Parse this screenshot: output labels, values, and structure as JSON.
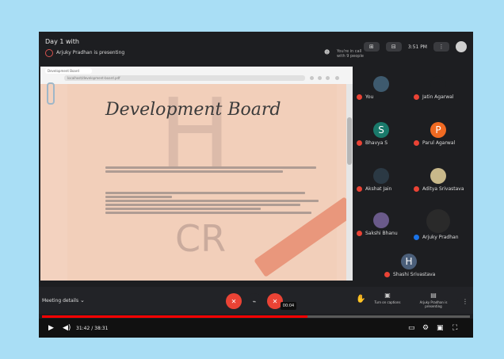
{
  "meeting": {
    "title": "Day 1 with",
    "presenting": "Arjuky Pradhan is presenting"
  },
  "topbar": {
    "hand_text": "You're in call with 9 people",
    "time": "3:51 PM"
  },
  "browser": {
    "tab": "Development Board",
    "address": "localhost/development-board.pdf"
  },
  "slide": {
    "title": "Development Board",
    "logo": "CR"
  },
  "participants": [
    {
      "name": "You",
      "mic": "off",
      "color": "#3e5a6e",
      "letter": ""
    },
    {
      "name": "Jatin Agarwal",
      "mic": "off",
      "color": "#1d1e21",
      "letter": ""
    },
    {
      "name": "Bhavya S",
      "mic": "off",
      "color": "#1a7a6b",
      "letter": "S"
    },
    {
      "name": "Parul Agarwal",
      "mic": "off",
      "color": "#f06a22",
      "letter": "P"
    },
    {
      "name": "Akshat Jain",
      "mic": "off",
      "color": "#2b3944",
      "letter": ""
    },
    {
      "name": "Aditya Srivastava",
      "mic": "off",
      "color": "#c8b88a",
      "letter": ""
    },
    {
      "name": "Sakshi Bhanu",
      "mic": "off",
      "color": "#6a5a8a",
      "letter": ""
    },
    {
      "name": "Arjuky Pradhan",
      "mic": "on",
      "color": "#2a2a2a",
      "letter": ""
    },
    {
      "name": "Shashi Srivastava",
      "mic": "off",
      "color": "#4b5f7a",
      "letter": "H"
    }
  ],
  "controls": {
    "meeting_details": "Meeting details",
    "tooltip": "00:04",
    "captions": "Turn on captions",
    "present": "Arjuky Pradhan is presenting"
  },
  "player": {
    "time": "31:42 / 38:31",
    "progress": 0.62
  }
}
